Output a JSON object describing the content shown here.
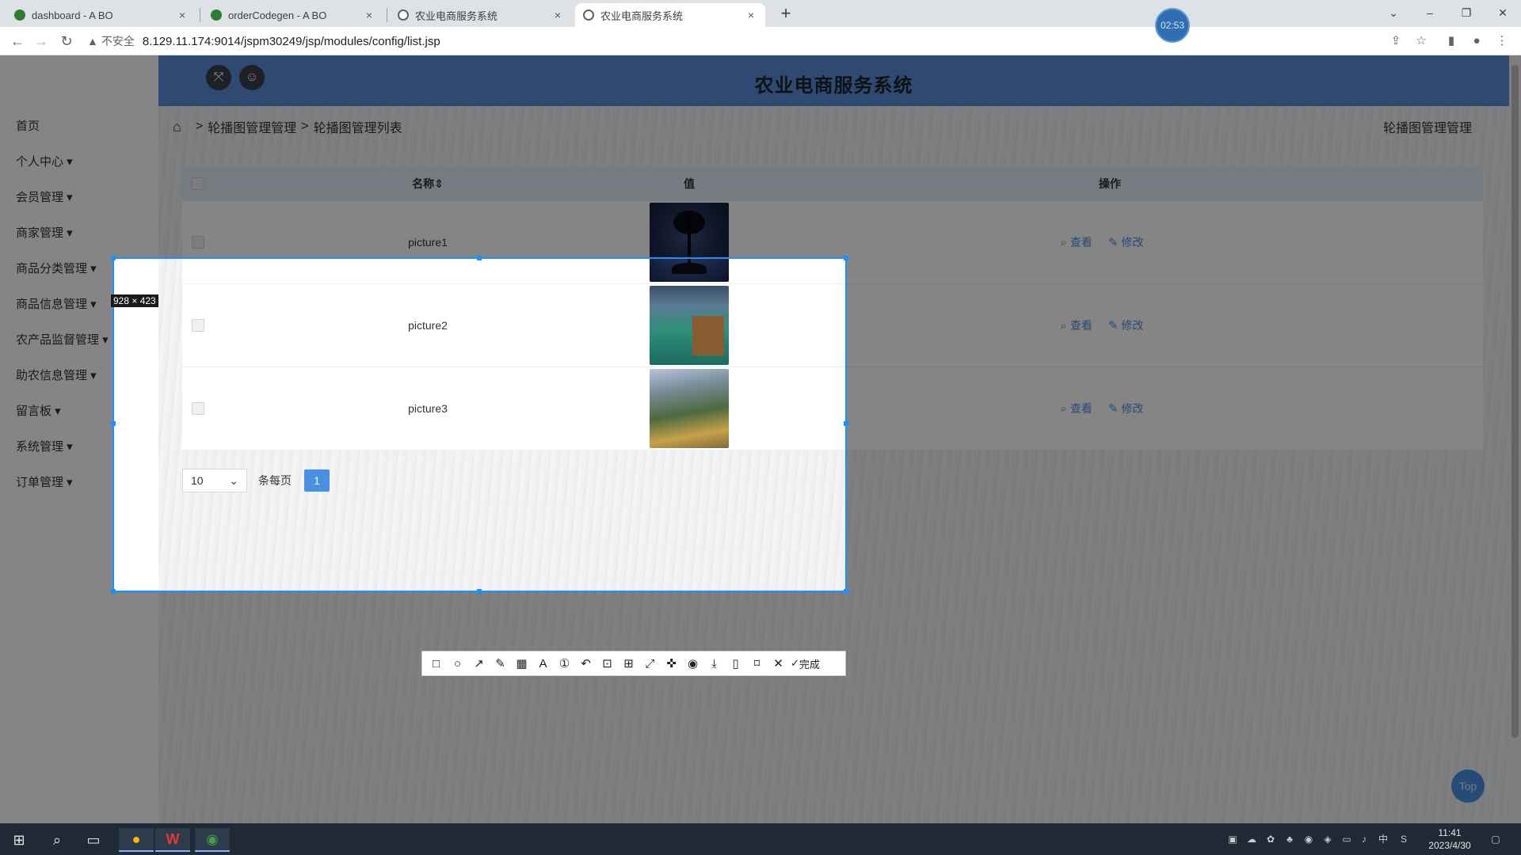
{
  "browser": {
    "tabs": [
      {
        "title": "dashboard - A BO",
        "active": false
      },
      {
        "title": "orderCodegen - A BO",
        "active": false
      },
      {
        "title": "农业电商服务系统",
        "active": false
      },
      {
        "title": "农业电商服务系统",
        "active": true
      }
    ],
    "tab_close": "×",
    "new_tab": "+",
    "timer": "02:53",
    "security_warning": "不安全",
    "url": "8.129.11.174:9014/jspm30249/jsp/modules/config/list.jsp"
  },
  "header": {
    "site_title": "农业电商服务系统"
  },
  "sidebar": {
    "items": [
      {
        "label": "首页"
      },
      {
        "label": "个人中心 ▾"
      },
      {
        "label": "会员管理 ▾"
      },
      {
        "label": "商家管理 ▾"
      },
      {
        "label": "商品分类管理 ▾"
      },
      {
        "label": "商品信息管理 ▾"
      },
      {
        "label": "农产品监督管理 ▾"
      },
      {
        "label": "助农信息管理 ▾"
      },
      {
        "label": "留言板 ▾"
      },
      {
        "label": "系统管理 ▾"
      },
      {
        "label": "订单管理 ▾"
      }
    ]
  },
  "breadcrumb": {
    "items": [
      "轮播图管理管理",
      "轮播图管理列表"
    ],
    "separator": ">",
    "right": "轮播图管理管理"
  },
  "table": {
    "columns": {
      "name": "名称⇕",
      "value": "值",
      "actions": "操作"
    },
    "rows": [
      {
        "name": "picture1",
        "image": "night-tree"
      },
      {
        "name": "picture2",
        "image": "lake-house"
      },
      {
        "name": "picture3",
        "image": "mountain-town"
      }
    ],
    "view_label": "查看",
    "edit_label": "修改"
  },
  "pagination": {
    "page_size": "10",
    "per_page_label": "条每页",
    "current_page": "1"
  },
  "screenshot_tool": {
    "size_label": "928 × 423",
    "done_label": "完成"
  },
  "back_to_top": "Top",
  "taskbar": {
    "time": "11:41",
    "date": "2023/4/30",
    "ime": "中"
  },
  "colors": {
    "topbar": "#5a8fd6",
    "accent": "#4a90e2",
    "selection": "#1e8fff"
  }
}
